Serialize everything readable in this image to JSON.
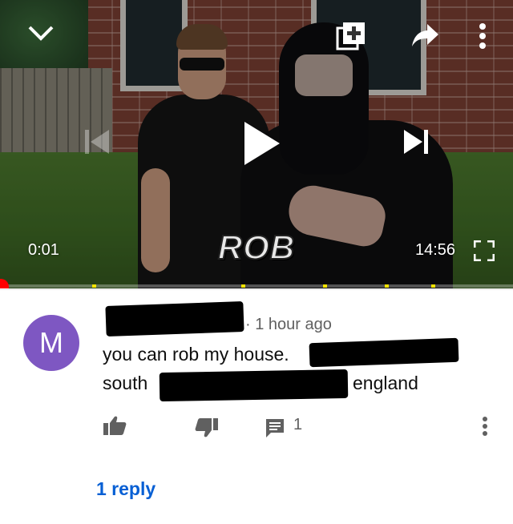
{
  "player": {
    "elapsed_time": "0:01",
    "total_time": "14:56",
    "overlay_caption": "ROB",
    "progress_fraction": 0.001,
    "ad_markers_fraction": [
      0.18,
      0.47,
      0.63,
      0.75,
      0.84
    ],
    "icons": {
      "collapse": "chevron-down-icon",
      "add_to_playlist": "add-to-playlist-icon",
      "share": "share-icon",
      "more": "more-vertical-icon",
      "previous": "skip-previous-icon",
      "play": "play-icon",
      "next": "skip-next-icon",
      "fullscreen": "fullscreen-icon"
    },
    "accent_color": "#ff0000",
    "marker_color": "#f5e400"
  },
  "comment": {
    "avatar_letter": "M",
    "avatar_color": "#7e57c2",
    "timestamp": "1 hour ago",
    "line1": "you can rob my house.",
    "line2_start": "south",
    "line2_end": "england",
    "reply_count": "1",
    "replies_link": "1 reply",
    "link_color": "#065fd4"
  }
}
